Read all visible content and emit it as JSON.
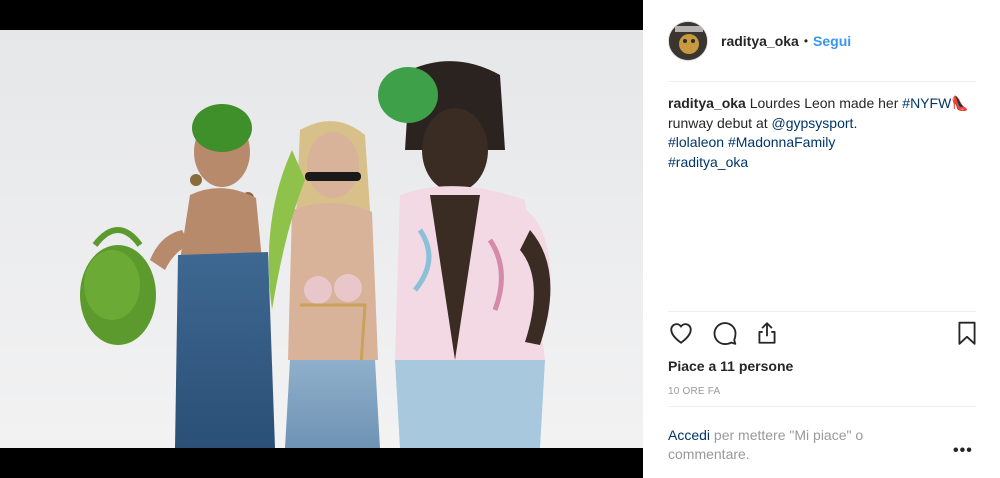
{
  "post": {
    "username": "raditya_oka",
    "separator": "•",
    "follow_label": "Segui"
  },
  "caption": {
    "username": "raditya_oka",
    "text_1": " Lourdes Leon made her ",
    "tag_nyfw": "#NYFW",
    "emoji": "👠",
    "text_2": " runway debut at ",
    "mention": "@gypsysport",
    "text_3": ".",
    "tag_lolaleon": "#lolaleon",
    "tag_madonna": "#MadonnaFamily",
    "tag_raditya": "#raditya_oka"
  },
  "actions": {
    "like_icon": "heart-icon",
    "comment_icon": "comment-icon",
    "share_icon": "share-icon",
    "save_icon": "bookmark-icon"
  },
  "likes": {
    "text": "Piace a 11 persone"
  },
  "timestamp": "10 ORE FA",
  "login_prompt": {
    "link": "Accedi",
    "text": " per mettere \"Mi piace\" o commentare."
  },
  "more_label": "•••",
  "colors": {
    "link_blue": "#3897f0",
    "hashtag_blue": "#003569",
    "text": "#262626",
    "muted": "#999999"
  }
}
